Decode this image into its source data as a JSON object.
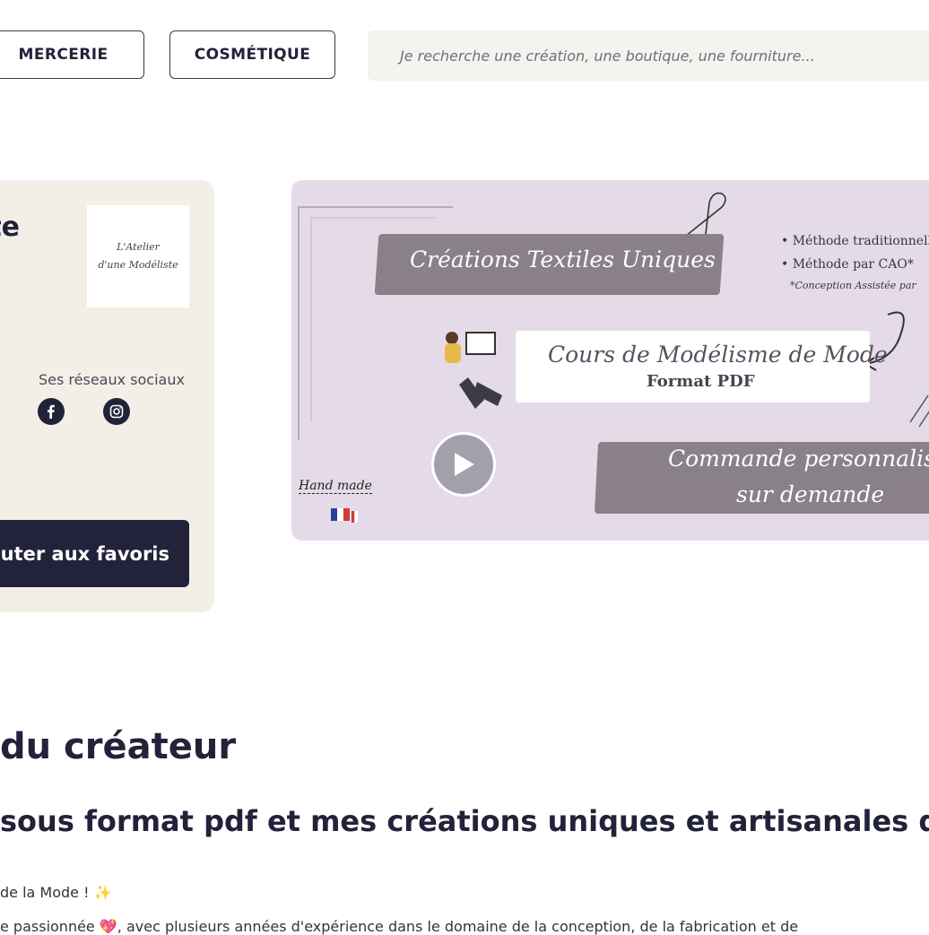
{
  "nav": {
    "buttons": [
      "MERCERIE",
      "COSMÉTIQUE"
    ],
    "search_placeholder": "Je recherche une création, une boutique, une fourniture..."
  },
  "shop": {
    "name_fragment": "te",
    "logo_text_line1": "L'Atelier",
    "logo_text_line2": "d'une Modéliste",
    "socials_label": "Ses réseaux sociaux",
    "social_icons": [
      "facebook-icon",
      "instagram-icon"
    ],
    "favorite_button": "outer aux favoris"
  },
  "banner": {
    "line1": "Créations Textiles Uniques",
    "bullets": [
      "Méthode traditionnelle",
      "Méthode par CAO*"
    ],
    "footnote": "*Conception Assistée par",
    "line2": "Cours de Modélisme de Mode",
    "line2_sub": "Format PDF",
    "line3a": "Commande personnalisée",
    "line3b": "sur demande",
    "handmade": "Hand made"
  },
  "description": {
    "heading": "du créateur",
    "subheading": "sous format pdf et mes créations uniques et artisanales da",
    "line1": "de la Mode ! ✨",
    "line2": "e passionnée 💖, avec plusieurs années d'expérience dans le domaine de la conception, de la fabrication et de"
  },
  "colors": {
    "primary_dark": "#22223a",
    "card_bg": "#f3efe6",
    "banner_bg": "#e5dbe8",
    "search_bg": "#f4f3ef"
  }
}
